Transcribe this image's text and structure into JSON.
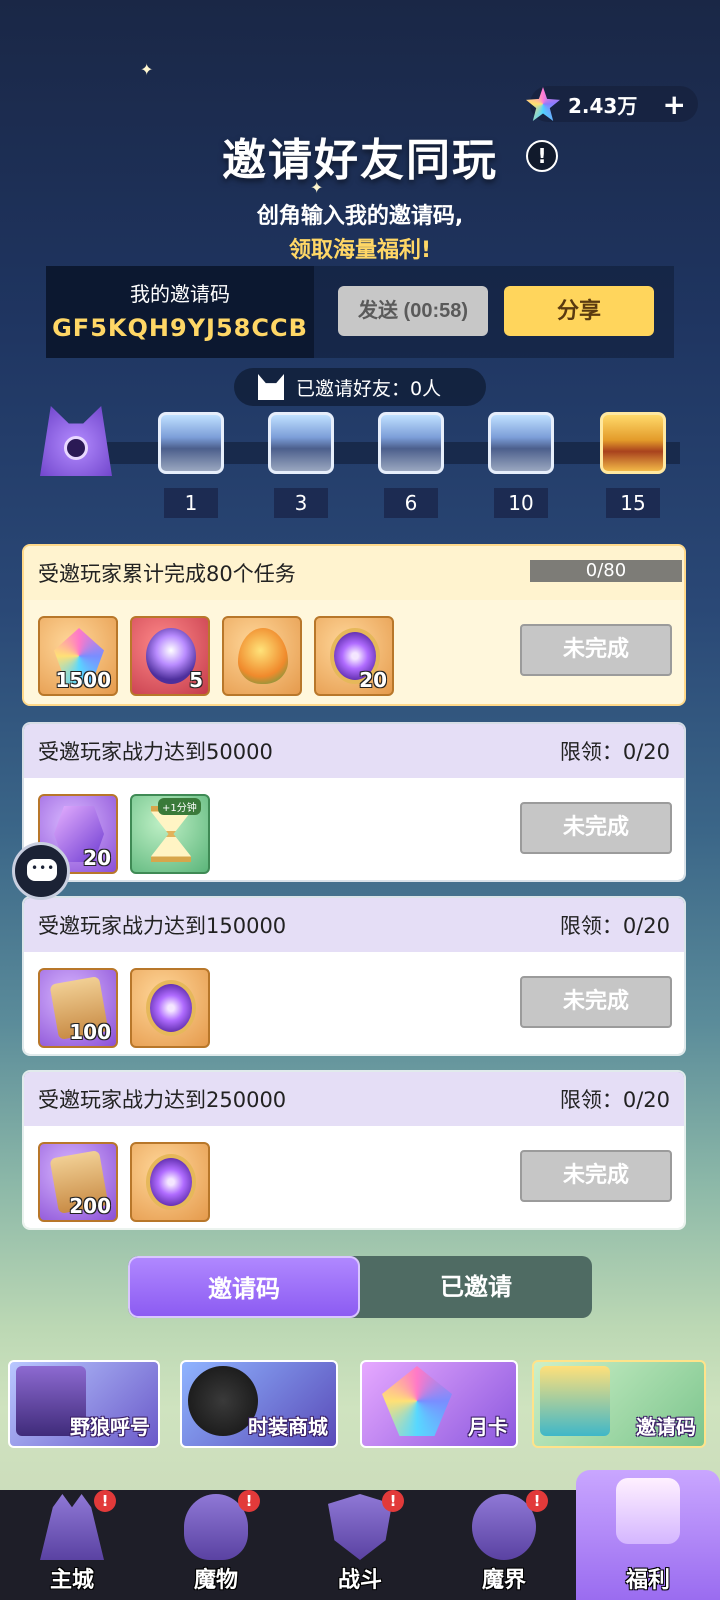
{
  "currency": {
    "value": "2.43万",
    "plus": "+",
    "icon": "star-gem-icon"
  },
  "header": {
    "title": "邀请好友同玩",
    "info": "!",
    "subtitle_line1": "创角输入我的邀请码,",
    "subtitle_line2": "领取海量福利!"
  },
  "invite_code": {
    "label": "我的邀请码",
    "code": "GF5KQH9YJ58CCB",
    "send_label": "发送 (00:58)",
    "share_label": "分享"
  },
  "invited_count": "已邀请好友：0人",
  "milestones": [
    "1",
    "3",
    "6",
    "10",
    "15"
  ],
  "tasks": [
    {
      "title": "受邀玩家累计完成80个任务",
      "progress_text": "0/80",
      "progress": 0,
      "rewards": [
        {
          "icon": "rainbow-crystal-icon",
          "qty": "1500"
        },
        {
          "icon": "magic-wand-icon",
          "qty": "5"
        },
        {
          "icon": "egg-icon",
          "qty": ""
        },
        {
          "icon": "purple-orb-icon",
          "qty": "20"
        }
      ],
      "button": "未完成"
    },
    {
      "title": "受邀玩家战力达到50000",
      "limit": "限领：0/20",
      "rewards": [
        {
          "icon": "purple-gem-icon",
          "qty": "20"
        },
        {
          "icon": "hourglass-icon",
          "qty": "",
          "badge": "+1分钟"
        }
      ],
      "button": "未完成"
    },
    {
      "title": "受邀玩家战力达到150000",
      "limit": "限领：0/20",
      "rewards": [
        {
          "icon": "scroll-icon",
          "qty": "100"
        },
        {
          "icon": "purple-orb-icon",
          "qty": ""
        }
      ],
      "button": "未完成"
    },
    {
      "title": "受邀玩家战力达到250000",
      "limit": "限领：0/20",
      "rewards": [
        {
          "icon": "scroll-icon",
          "qty": "200"
        },
        {
          "icon": "purple-orb-icon",
          "qty": ""
        }
      ],
      "button": "未完成"
    }
  ],
  "toggle": {
    "tab_a": "邀请码",
    "tab_b": "已邀请"
  },
  "promos": [
    "野狼呼号",
    "时装商城",
    "月卡",
    "邀请码"
  ],
  "nav": [
    {
      "label": "主城",
      "icon": "castle-icon",
      "alert": "!"
    },
    {
      "label": "魔物",
      "icon": "monster-icon",
      "alert": "!"
    },
    {
      "label": "战斗",
      "icon": "shield-sword-icon",
      "alert": "!"
    },
    {
      "label": "魔界",
      "icon": "demon-realm-icon",
      "alert": "!"
    },
    {
      "label": "福利",
      "icon": "gift-chest-icon"
    }
  ],
  "colors": {
    "accent_gold": "#ffd766",
    "accent_purple": "#9a6cf0"
  }
}
